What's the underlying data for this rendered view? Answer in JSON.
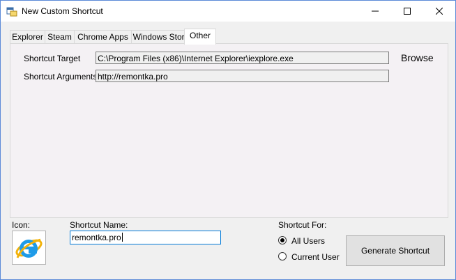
{
  "window": {
    "title": "New Custom Shortcut"
  },
  "tabs": [
    {
      "label": "Explorer"
    },
    {
      "label": "Steam"
    },
    {
      "label": "Chrome Apps"
    },
    {
      "label": "Windows Store"
    },
    {
      "label": "Other",
      "active": true
    }
  ],
  "other_tab": {
    "target_label": "Shortcut Target",
    "target_value": "C:\\Program Files (x86)\\Internet Explorer\\iexplore.exe",
    "args_label": "Shortcut Arguments",
    "args_value": "http://remontka.pro",
    "browse_label": "Browse"
  },
  "footer": {
    "icon_label": "Icon:",
    "icon_name": "internet-explorer-icon",
    "name_label": "Shortcut Name:",
    "name_value": "remontka.pro",
    "for_label": "Shortcut For:",
    "options": [
      {
        "label": "All Users",
        "selected": true
      },
      {
        "label": "Current User",
        "selected": false
      }
    ],
    "generate_label": "Generate Shortcut"
  },
  "colors": {
    "accent": "#0078d7",
    "ie_blue": "#1e9be8",
    "ie_gold": "#f2b20a"
  }
}
